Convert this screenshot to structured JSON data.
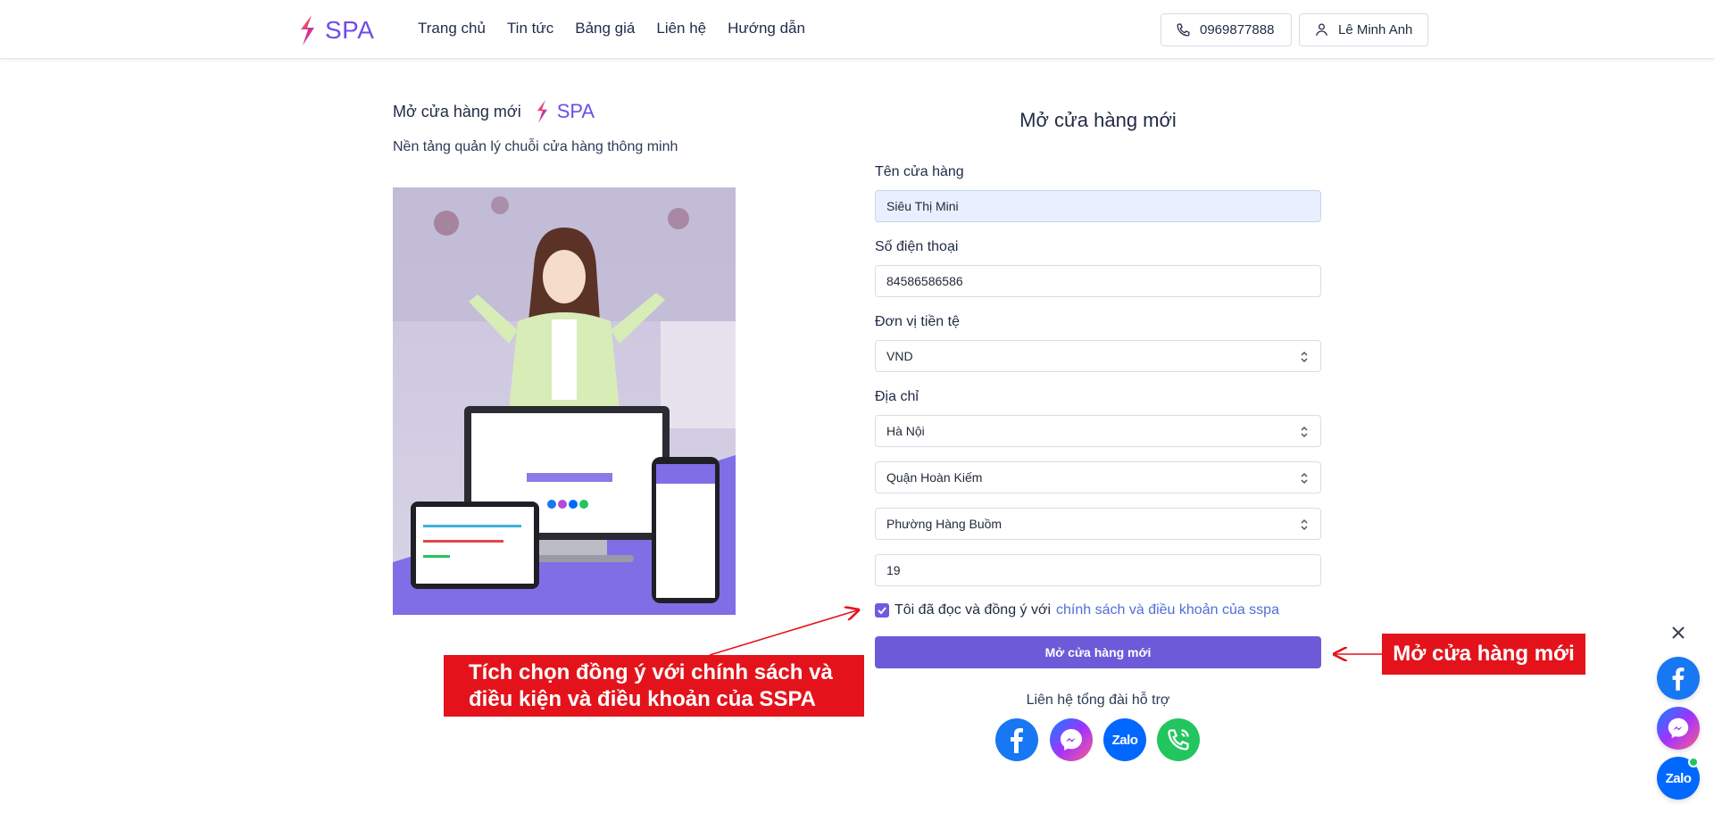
{
  "header": {
    "logo_text": "SPA",
    "nav": [
      "Trang chủ",
      "Tin tức",
      "Bảng giá",
      "Liên hệ",
      "Hướng dẫn"
    ],
    "phone": "0969877888",
    "user": "Lê Minh Anh"
  },
  "left": {
    "title": "Mở cửa hàng mới",
    "brand": "SPA",
    "subtitle": "Nền tảng quản lý chuỗi cửa hàng thông minh"
  },
  "form": {
    "title": "Mở cửa hàng mới",
    "store_name_label": "Tên cửa hàng",
    "store_name_value": "Siêu Thị Mini",
    "phone_label": "Số điện thoại",
    "phone_value": "84586586586",
    "currency_label": "Đơn vị tiền tệ",
    "currency_value": "VND",
    "address_label": "Địa chỉ",
    "province_value": "Hà Nội",
    "district_value": "Quận Hoàn Kiếm",
    "ward_value": "Phường Hàng Buồm",
    "street_value": "19",
    "agree_text": "Tôi đã đọc và đồng ý với",
    "agree_link": "chính sách và điều khoản của sspa",
    "agree_checked": true,
    "submit_label": "Mở cửa hàng mới",
    "support_text": "Liên hệ tổng đài hỗ trợ"
  },
  "annotations": {
    "left_line1": "Tích chọn đồng ý với chính sách và",
    "left_line2": "điều kiện và điều khoản của SSPA",
    "right": "Mở cửa hàng mới"
  },
  "widgets": {
    "zalo_label": "Zalo"
  },
  "colors": {
    "brand": "#6d4ee8",
    "button": "#6c5ad8",
    "callout": "#e4131b",
    "facebook": "#1877f2",
    "zalo": "#0068ff",
    "phone": "#22c55e"
  }
}
